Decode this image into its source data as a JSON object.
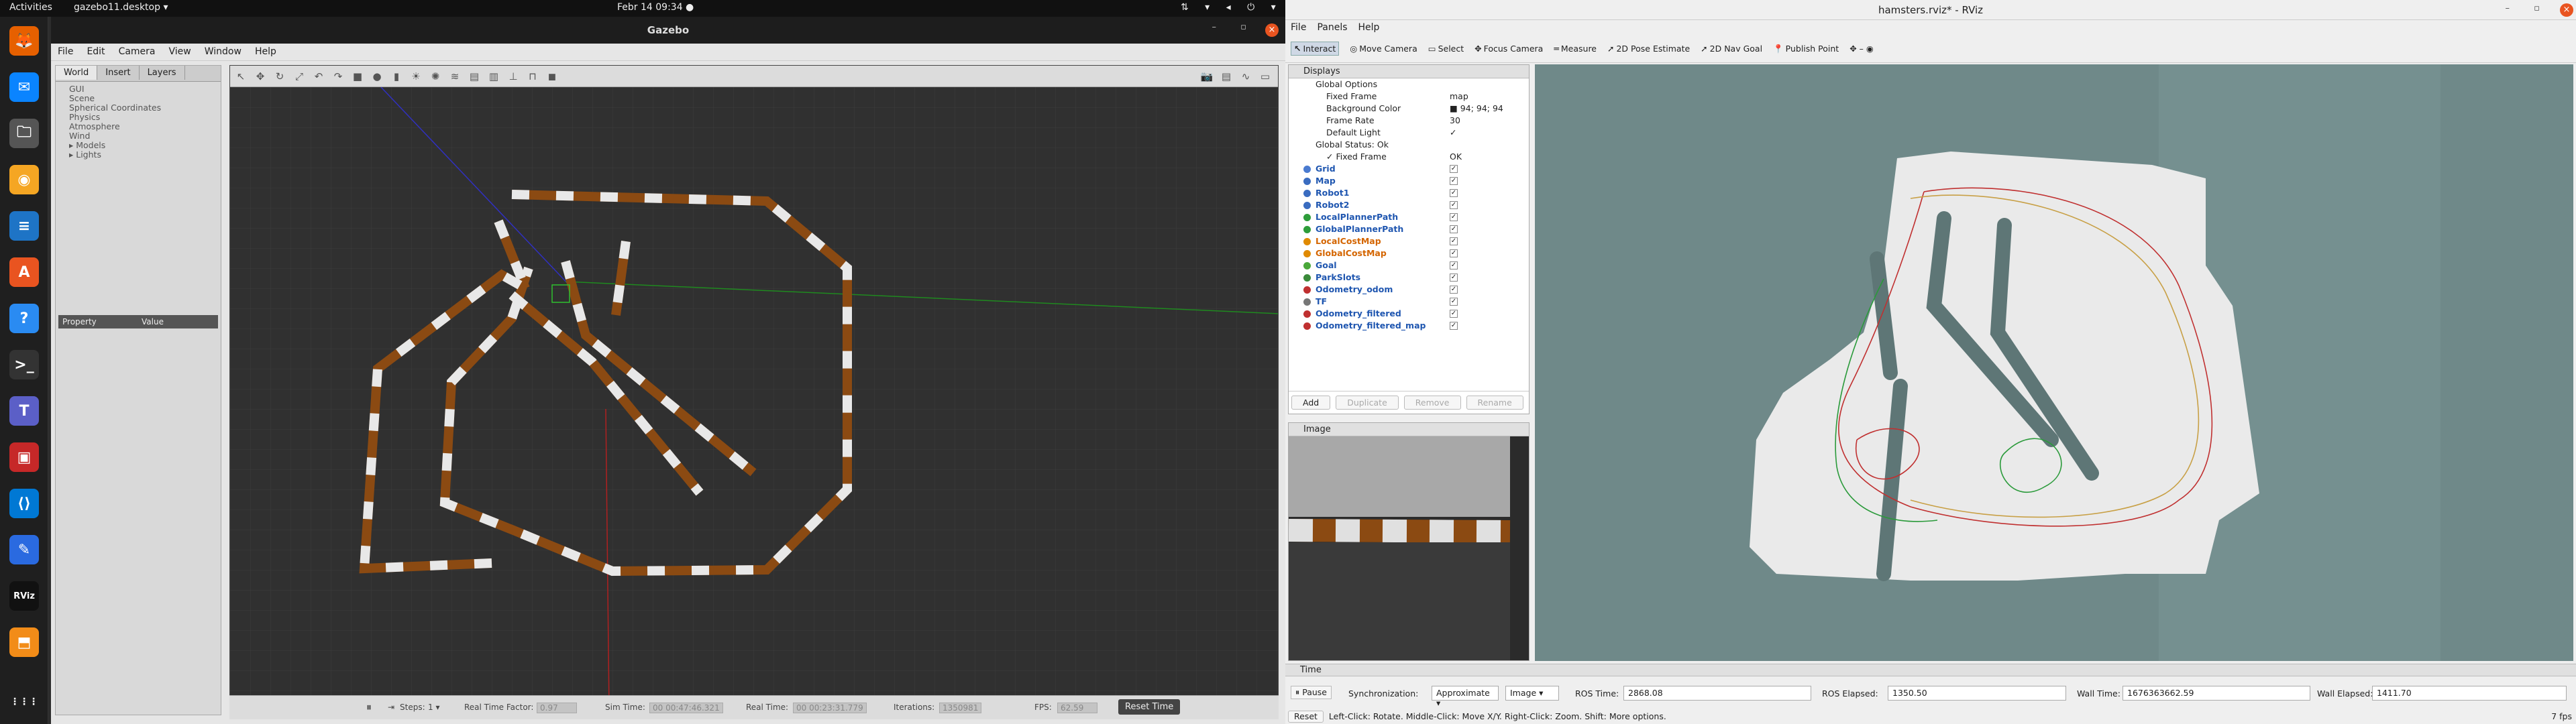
{
  "topbar": {
    "activities": "Activities",
    "app": "gazebo11.desktop ▾",
    "clock": "Febr 14  09:34  ●",
    "tray": "⇅ ▾ ◂ ⏻ ▾"
  },
  "dock": {
    "apps": [
      {
        "name": "firefox",
        "glyph": "🦊",
        "color": "#e66000"
      },
      {
        "name": "thunderbird",
        "glyph": "✉",
        "color": "#0a84ff"
      },
      {
        "name": "files",
        "glyph": "🗀",
        "color": "#555"
      },
      {
        "name": "rhythmbox",
        "glyph": "◉",
        "color": "#f5a623"
      },
      {
        "name": "writer",
        "glyph": "≡",
        "color": "#1e74c6"
      },
      {
        "name": "software",
        "glyph": "A",
        "color": "#e95420"
      },
      {
        "name": "help",
        "glyph": "?",
        "color": "#2a8bf2"
      },
      {
        "name": "terminal",
        "glyph": ">_",
        "color": "#333"
      },
      {
        "name": "teams",
        "glyph": "T",
        "color": "#5b5fc7"
      },
      {
        "name": "monitor",
        "glyph": "▣",
        "color": "#c62828"
      },
      {
        "name": "vscode",
        "glyph": "⟨⟩",
        "color": "#0078d4"
      },
      {
        "name": "editor",
        "glyph": "✎",
        "color": "#2a6ae0"
      },
      {
        "name": "rviz",
        "glyph": "RViz",
        "color": "#111"
      },
      {
        "name": "gazebo",
        "glyph": "⬒",
        "color": "#f28c18"
      }
    ],
    "grid_glyph": "⋮⋮⋮"
  },
  "gazebo": {
    "title": "Gazebo",
    "window_buttons": "– ▫",
    "close": "×",
    "menu": [
      "File",
      "Edit",
      "Camera",
      "View",
      "Window",
      "Help"
    ],
    "tabs": [
      "World",
      "Insert",
      "Layers"
    ],
    "tree": [
      "GUI",
      "Scene",
      "Spherical Coordinates",
      "Physics",
      "Atmosphere",
      "Wind",
      "▸ Models",
      "▸ Lights"
    ],
    "props": {
      "property": "Property",
      "value": "Value"
    },
    "toolbar_icons": [
      "↖",
      "✥",
      "↻",
      "⤢",
      "↶",
      "↷",
      "■",
      "●",
      "▮",
      "☀",
      "✺",
      "≋",
      "▤",
      "▥",
      "⊥",
      "⊓",
      "◼"
    ],
    "right_icons": [
      "📷",
      "▤",
      "∿",
      "▭"
    ],
    "bottom": {
      "pause": "⏸",
      "step": "⇥",
      "steps_label": "Steps:",
      "steps_val": "1 ▾",
      "rtf_label": "Real Time Factor:",
      "rtf": "0.97",
      "sim_label": "Sim Time:",
      "sim": "00 00:47:46.321",
      "real_label": "Real Time:",
      "real": "00 00:23:31.779",
      "iter_label": "Iterations:",
      "iter": "1350981",
      "fps_label": "FPS:",
      "fps": "62.59",
      "reset": "Reset Time"
    }
  },
  "rviz": {
    "title": "hamsters.rviz* - RViz",
    "window_buttons": "– ▫",
    "close": "×",
    "menu": [
      "File",
      "Panels",
      "Help"
    ],
    "tools": [
      {
        "icon": "↖",
        "label": "Interact"
      },
      {
        "icon": "◎",
        "label": "Move Camera"
      },
      {
        "icon": "▭",
        "label": "Select"
      },
      {
        "icon": "✥",
        "label": "Focus Camera"
      },
      {
        "icon": "═",
        "label": "Measure"
      },
      {
        "icon": "➚",
        "label": "2D Pose Estimate"
      },
      {
        "icon": "➚",
        "label": "2D Nav Goal"
      },
      {
        "icon": "📍",
        "label": "Publish Point"
      }
    ],
    "tool_extras": "✥ – ◉",
    "displays": {
      "header": "Displays",
      "global": [
        {
          "label": "Global Options",
          "value": ""
        },
        {
          "label": "Fixed Frame",
          "value": "map"
        },
        {
          "label": "Background Color",
          "value": "■ 94; 94; 94"
        },
        {
          "label": "Frame Rate",
          "value": "30"
        },
        {
          "label": "Default Light",
          "value": "✓"
        },
        {
          "label": "Global Status: Ok",
          "value": ""
        },
        {
          "label": "✓ Fixed Frame",
          "value": "OK"
        }
      ],
      "items": [
        {
          "label": "Grid",
          "cls": "blue",
          "dot": "#4a7bd0"
        },
        {
          "label": "Map",
          "cls": "blue",
          "dot": "#3a6cc0"
        },
        {
          "label": "Robot1",
          "cls": "blue",
          "dot": "#3a6cc0"
        },
        {
          "label": "Robot2",
          "cls": "blue",
          "dot": "#3a6cc0"
        },
        {
          "label": "LocalPlannerPath",
          "cls": "blue",
          "dot": "#2e9d3a"
        },
        {
          "label": "GlobalPlannerPath",
          "cls": "blue",
          "dot": "#2e9d3a"
        },
        {
          "label": "LocalCostMap",
          "cls": "orange",
          "dot": "#e08a00"
        },
        {
          "label": "GlobalCostMap",
          "cls": "orange",
          "dot": "#e08a00"
        },
        {
          "label": "Goal",
          "cls": "blue",
          "dot": "#4aa83a"
        },
        {
          "label": "ParkSlots",
          "cls": "blue",
          "dot": "#3a8a3a"
        },
        {
          "label": "Odometry_odom",
          "cls": "blue",
          "dot": "#c03030"
        },
        {
          "label": "TF",
          "cls": "blue",
          "dot": "#777"
        },
        {
          "label": "Odometry_filtered",
          "cls": "blue",
          "dot": "#c03030"
        },
        {
          "label": "Odometry_filtered_map",
          "cls": "blue",
          "dot": "#c03030"
        }
      ],
      "check": "✓",
      "buttons": [
        "Add",
        "Duplicate",
        "Remove",
        "Rename"
      ]
    },
    "image_panel": {
      "header": "Image"
    },
    "time": {
      "header": "Time",
      "pause": "⏸ Pause",
      "sync_label": "Synchronization:",
      "sync": "Approximate ▾",
      "sync2": "Image ▾",
      "ros_time_label": "ROS Time:",
      "ros_time": "2868.08",
      "ros_elapsed_label": "ROS Elapsed:",
      "ros_elapsed": "1350.50",
      "wall_time_label": "Wall Time:",
      "wall_time": "1676363662.59",
      "wall_elapsed_label": "Wall Elapsed:",
      "wall_elapsed": "1411.70"
    },
    "status": {
      "reset": "Reset",
      "text": "Left-Click: Rotate.  Middle-Click: Move X/Y.  Right-Click: Zoom.  Shift: More options.",
      "fps": "7 fps"
    }
  }
}
